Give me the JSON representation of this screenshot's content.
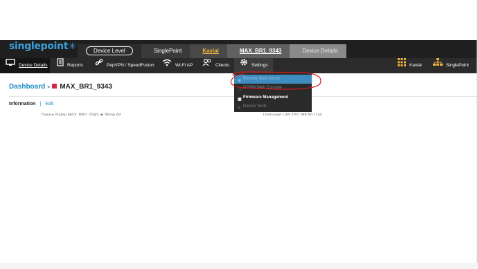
{
  "logo": {
    "text": "singlepoint",
    "star": "✳"
  },
  "breadcrumbs": {
    "level": "Device Level",
    "org": "SinglePoint",
    "group": "Kavial",
    "device": "MAX_BR1_9343",
    "page": "Device Details"
  },
  "nav": {
    "device_details": "Device Details",
    "reports": "Reports",
    "pepvpn": "PepVPN / SpeedFusion",
    "wifi": "Wi-Fi AP",
    "clients": "Clients",
    "settings": "Settings",
    "kavial": "Kavial",
    "singlepoint": "SinglePoint"
  },
  "page": {
    "dashboard": "Dashboard",
    "separator": ">",
    "device_name": "MAX_BR1_9343",
    "information": "Information",
    "divider": "|",
    "edit": "Edit",
    "partial_left": "Device Name    MAX_BR1_9343 ★  Show All",
    "partial_right": "Untrusted LAN    192.168.50.1/24"
  },
  "settings_menu": {
    "items": [
      {
        "label": "Remote Web Admin",
        "icon": "globe-icon"
      },
      {
        "label": "DOBM Web Console",
        "icon": "monitor-icon"
      },
      {
        "label": "Firmware Management",
        "icon": "firmware-icon"
      },
      {
        "label": "Device Tools",
        "icon": "wrench-icon"
      }
    ]
  },
  "colors": {
    "brand_blue": "#1e8bc3",
    "accent_orange": "#f2b53a",
    "annotation_red": "#d11a1a",
    "menu_highlight": "#3f8cc0"
  }
}
